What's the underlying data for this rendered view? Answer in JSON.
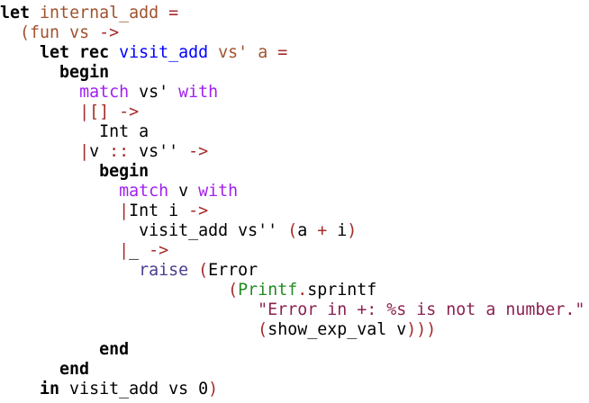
{
  "palette": {
    "background": "#ffffff",
    "keyword": "#000000",
    "binding_name": "#a0522d",
    "function_name": "#0000ff",
    "match_keyword": "#a020f0",
    "punctuation": "#a52a2a",
    "module": "#228b22",
    "string": "#8b2252",
    "raise": "#483d8b"
  },
  "code": {
    "lines": [
      [
        {
          "t": "let",
          "c": "kw"
        },
        {
          "t": " ",
          "c": "plain"
        },
        {
          "t": "internal_add",
          "c": "name"
        },
        {
          "t": " ",
          "c": "plain"
        },
        {
          "t": "=",
          "c": "punct"
        }
      ],
      [
        {
          "t": "  ",
          "c": "plain"
        },
        {
          "t": "(fun",
          "c": "name"
        },
        {
          "t": " ",
          "c": "plain"
        },
        {
          "t": "vs",
          "c": "name"
        },
        {
          "t": " ",
          "c": "plain"
        },
        {
          "t": "->",
          "c": "punct"
        }
      ],
      [
        {
          "t": "    ",
          "c": "plain"
        },
        {
          "t": "let rec",
          "c": "kw"
        },
        {
          "t": " ",
          "c": "plain"
        },
        {
          "t": "visit_add",
          "c": "def"
        },
        {
          "t": " ",
          "c": "plain"
        },
        {
          "t": "vs'",
          "c": "name"
        },
        {
          "t": " ",
          "c": "plain"
        },
        {
          "t": "a",
          "c": "name"
        },
        {
          "t": " ",
          "c": "plain"
        },
        {
          "t": "=",
          "c": "punct"
        }
      ],
      [
        {
          "t": "      ",
          "c": "plain"
        },
        {
          "t": "begin",
          "c": "kw"
        }
      ],
      [
        {
          "t": "        ",
          "c": "plain"
        },
        {
          "t": "match",
          "c": "match"
        },
        {
          "t": " vs' ",
          "c": "plain"
        },
        {
          "t": "with",
          "c": "match"
        }
      ],
      [
        {
          "t": "        ",
          "c": "plain"
        },
        {
          "t": "|[] ->",
          "c": "punct"
        }
      ],
      [
        {
          "t": "          ",
          "c": "plain"
        },
        {
          "t": "Int a",
          "c": "plain"
        }
      ],
      [
        {
          "t": "        ",
          "c": "plain"
        },
        {
          "t": "|",
          "c": "punct"
        },
        {
          "t": "v ",
          "c": "plain"
        },
        {
          "t": "::",
          "c": "punct"
        },
        {
          "t": " vs'' ",
          "c": "plain"
        },
        {
          "t": "->",
          "c": "punct"
        }
      ],
      [
        {
          "t": "          ",
          "c": "plain"
        },
        {
          "t": "begin",
          "c": "kw"
        }
      ],
      [
        {
          "t": "            ",
          "c": "plain"
        },
        {
          "t": "match",
          "c": "match"
        },
        {
          "t": " v ",
          "c": "plain"
        },
        {
          "t": "with",
          "c": "match"
        }
      ],
      [
        {
          "t": "            ",
          "c": "plain"
        },
        {
          "t": "|",
          "c": "punct"
        },
        {
          "t": "Int i ",
          "c": "plain"
        },
        {
          "t": "->",
          "c": "punct"
        }
      ],
      [
        {
          "t": "              ",
          "c": "plain"
        },
        {
          "t": "visit_add vs'' ",
          "c": "plain"
        },
        {
          "t": "(",
          "c": "punct"
        },
        {
          "t": "a ",
          "c": "plain"
        },
        {
          "t": "+",
          "c": "punct"
        },
        {
          "t": " i",
          "c": "plain"
        },
        {
          "t": ")",
          "c": "punct"
        }
      ],
      [
        {
          "t": "            ",
          "c": "plain"
        },
        {
          "t": "|",
          "c": "punct"
        },
        {
          "t": "_ ",
          "c": "plain"
        },
        {
          "t": "->",
          "c": "punct"
        }
      ],
      [
        {
          "t": "              ",
          "c": "plain"
        },
        {
          "t": "raise",
          "c": "raise"
        },
        {
          "t": " ",
          "c": "plain"
        },
        {
          "t": "(",
          "c": "punct"
        },
        {
          "t": "Error",
          "c": "plain"
        }
      ],
      [
        {
          "t": "                       ",
          "c": "plain"
        },
        {
          "t": "(",
          "c": "punct"
        },
        {
          "t": "Printf",
          "c": "mod"
        },
        {
          "t": ".",
          "c": "punct"
        },
        {
          "t": "sprintf",
          "c": "plain"
        }
      ],
      [
        {
          "t": "                          ",
          "c": "plain"
        },
        {
          "t": "\"Error in +: %s is not a number.\"",
          "c": "str"
        }
      ],
      [
        {
          "t": "                          ",
          "c": "plain"
        },
        {
          "t": "(",
          "c": "punct"
        },
        {
          "t": "show_exp_val v",
          "c": "plain"
        },
        {
          "t": ")))",
          "c": "punct"
        }
      ],
      [
        {
          "t": "          ",
          "c": "plain"
        },
        {
          "t": "end",
          "c": "kw"
        }
      ],
      [
        {
          "t": "      ",
          "c": "plain"
        },
        {
          "t": "end",
          "c": "kw"
        }
      ],
      [
        {
          "t": "    ",
          "c": "plain"
        },
        {
          "t": "in",
          "c": "kw"
        },
        {
          "t": " visit_add vs 0",
          "c": "plain"
        },
        {
          "t": ")",
          "c": "punct"
        }
      ]
    ]
  }
}
